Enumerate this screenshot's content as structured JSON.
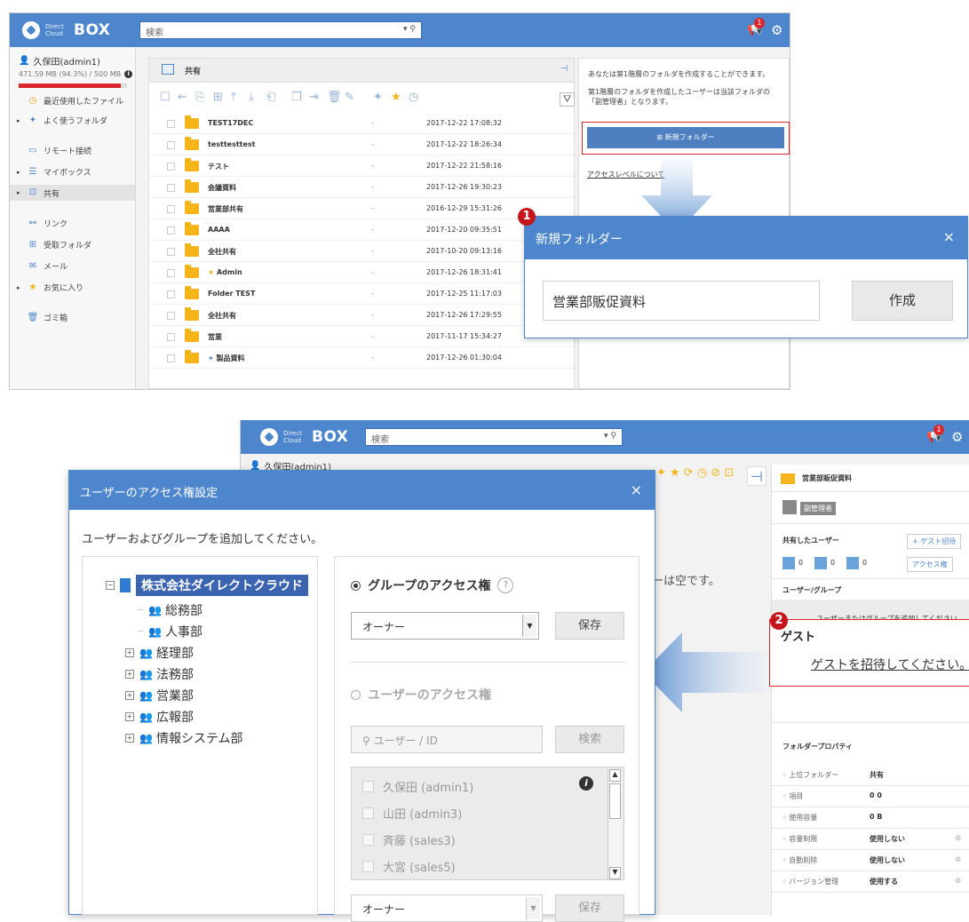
{
  "app": {
    "logo_small": "Direct Cloud",
    "logo_text": "BOX",
    "search_placeholder": "検索",
    "notify_count": "1"
  },
  "shot1": {
    "user": "久保田(admin1)",
    "usage": "471.59 MB (94.3%) / 500 MB",
    "usage_fraction": 0.943,
    "sidebar": [
      {
        "label": "最近使用したファイル",
        "icon": "clock-icon",
        "arrow": false
      },
      {
        "label": "よく使うフォルダ",
        "icon": "pin-icon",
        "arrow": true
      },
      {
        "label": "リモート接続",
        "icon": "monitor-icon",
        "arrow": false
      },
      {
        "label": "マイボックス",
        "icon": "box-icon",
        "arrow": true
      },
      {
        "label": "共有",
        "icon": "shared-icon",
        "arrow": true
      },
      {
        "label": "リンク",
        "icon": "link-icon",
        "arrow": false
      },
      {
        "label": "受取フォルダ",
        "icon": "inbox-icon",
        "arrow": false
      },
      {
        "label": "メール",
        "icon": "mail-icon",
        "arrow": false
      },
      {
        "label": "お気に入り",
        "icon": "star-icon",
        "arrow": true
      },
      {
        "label": "ゴミ箱",
        "icon": "trash-icon",
        "arrow": false
      }
    ],
    "breadcrumb": "共有",
    "files": [
      {
        "name": "TEST17DEC",
        "size": "-",
        "date": "2017-12-22 17:08:32"
      },
      {
        "name": "testtesttest",
        "size": "-",
        "date": "2017-12-22 18:26:34"
      },
      {
        "name": "テスト",
        "size": "-",
        "date": "2017-12-22 21:58:16"
      },
      {
        "name": "会議資料",
        "size": "-",
        "date": "2017-12-26 19:30:23"
      },
      {
        "name": "営業部共有",
        "size": "-",
        "date": "2016-12-29 15:31:26"
      },
      {
        "name": "AAAA",
        "size": "-",
        "date": "2017-12-20 09:35:51"
      },
      {
        "name": "全社共有",
        "size": "-",
        "date": "2017-10-20 09:13:16"
      },
      {
        "name": "Admin",
        "size": "-",
        "date": "2017-12-26 18:31:41"
      },
      {
        "name": "Folder TEST",
        "size": "-",
        "date": "2017-12-25 11:17:03"
      },
      {
        "name": "全社共有",
        "size": "-",
        "date": "2017-12-26 17:29:55"
      },
      {
        "name": "営業",
        "size": "-",
        "date": "2017-11-17 15:34:27"
      },
      {
        "name": "製品資料",
        "size": "-",
        "date": "2017-12-26 01:30:04"
      }
    ],
    "right_text1": "あなたは第1階層のフォルダを作成することができます。",
    "right_text2": "第1階層のフォルダを作成したユーザーは当該フォルダの「副管理者」となります。",
    "new_folder_btn": "新規フォルダー",
    "access_level_link": "アクセスレベルについて"
  },
  "dialog1": {
    "step": "1",
    "title": "新規フォルダー",
    "close": "×",
    "input_value": "営業部販促資料",
    "create_btn": "作成"
  },
  "shot2": {
    "user": "久保田(admin1)",
    "folder_title": "営業部販促資料",
    "role": "副管理者",
    "shared_users": "共有したユーザー",
    "invite_guest": "+ ゲスト招待",
    "count_a": "0",
    "count_b": "0",
    "count_c": "0",
    "access_btn": "アクセス権",
    "user_group": "ユーザー/グループ",
    "add_user_group": "ユーザーまたはグループを追加してください。",
    "empty_msg": "ダーは空です。",
    "properties_title": "フォルダープロパティ",
    "props": [
      {
        "key": "上位フォルダー",
        "val": "共有"
      },
      {
        "key": "項目",
        "val": "0     0"
      },
      {
        "key": "使用容量",
        "val": "0 B"
      },
      {
        "key": "容量制限",
        "val": "使用しない"
      },
      {
        "key": "自動削除",
        "val": "使用しない"
      },
      {
        "key": "バージョン管理",
        "val": "使用する"
      }
    ],
    "guest_step": "2",
    "guest_title": "ゲスト",
    "guest_link": "ゲストを招待してください。"
  },
  "dialog2": {
    "title": "ユーザーのアクセス権設定",
    "close": "×",
    "subtitle": "ユーザーおよびグループを追加してください。",
    "tree_root": "株式会社ダイレクトクラウド",
    "tree": [
      {
        "label": "総務部",
        "expandable": false
      },
      {
        "label": "人事部",
        "expandable": false
      },
      {
        "label": "経理部",
        "expandable": true
      },
      {
        "label": "法務部",
        "expandable": true
      },
      {
        "label": "営業部",
        "expandable": true
      },
      {
        "label": "広報部",
        "expandable": true
      },
      {
        "label": "情報システム部",
        "expandable": true
      }
    ],
    "group_access_label": "グループのアクセス権",
    "help": "?",
    "group_select": "オーナー",
    "save": "保存",
    "user_access_label": "ユーザーのアクセス権",
    "user_search_placeholder": "ユーザー / ID",
    "search_btn": "検索",
    "users": [
      "久保田 (admin1)",
      "山田 (admin3)",
      "斉藤 (sales3)",
      "大宮 (sales5)"
    ],
    "user_select": "オーナー",
    "save2": "保存"
  },
  "colors": {
    "accent": "#4d86cc",
    "highlight": "#d9262b",
    "folder": "#f5b51a"
  }
}
